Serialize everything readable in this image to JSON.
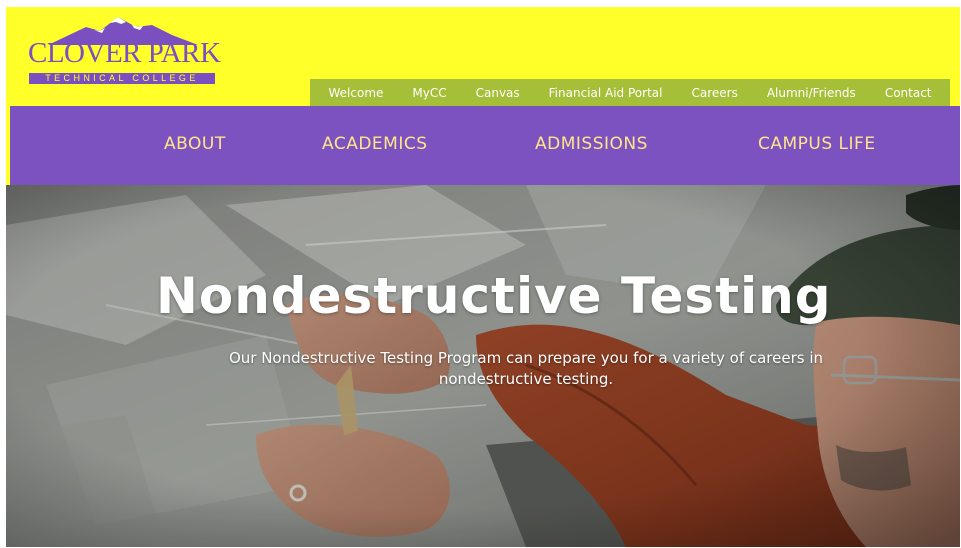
{
  "header": {
    "logo": {
      "name": "CLOVER PARK",
      "subtitle": "TECHNICAL COLLEGE"
    },
    "colors": {
      "header_bg": "#ffff29",
      "brand_purple": "#7b52c0",
      "util_green": "#a6bf38"
    }
  },
  "util_nav": {
    "items": [
      {
        "label": "Welcome"
      },
      {
        "label": "MyCC"
      },
      {
        "label": "Canvas"
      },
      {
        "label": "Financial Aid Portal"
      },
      {
        "label": "Careers"
      },
      {
        "label": "Alumni/Friends"
      },
      {
        "label": "Contact"
      }
    ]
  },
  "main_nav": {
    "items": [
      {
        "label": "ABOUT"
      },
      {
        "label": "ACADEMICS"
      },
      {
        "label": "ADMISSIONS"
      },
      {
        "label": "CAMPUS LIFE"
      }
    ]
  },
  "hero": {
    "title": "Nondestructive Testing",
    "subtitle": "Our Nondestructive Testing Program can prepare you for a variety of careers in nondestructive testing."
  }
}
